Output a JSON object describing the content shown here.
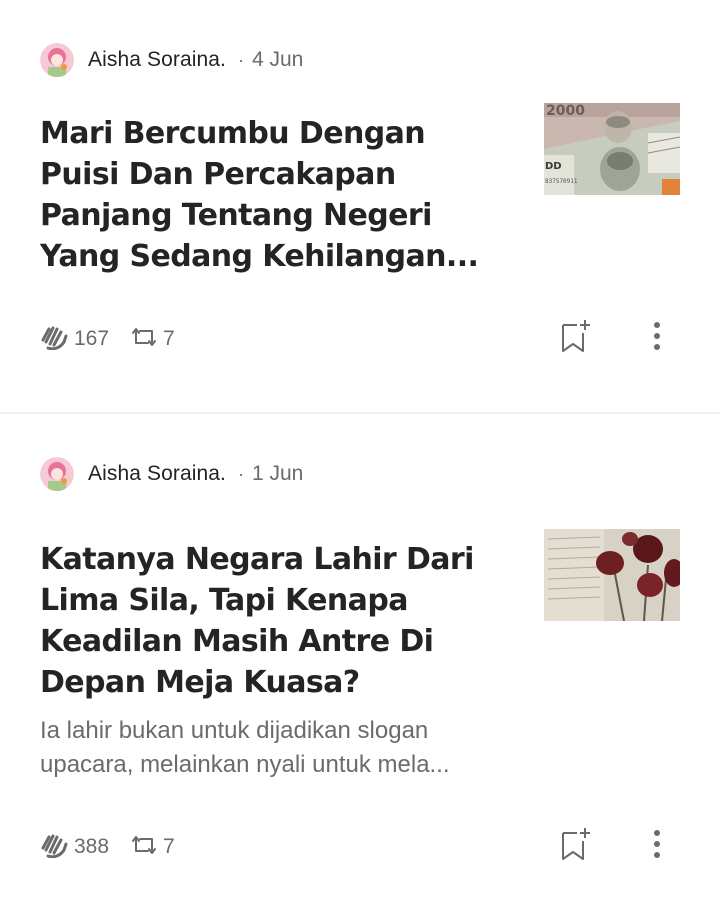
{
  "posts": [
    {
      "author": "Aisha Soraina.",
      "separator": "·",
      "date": "4 Jun",
      "title": "Mari Bercumbu Dengan Puisi Dan Percakapan Panjang Tentang Negeri Yang Sedang Kehilangan...",
      "subtitle": "",
      "claps": "167",
      "responses": "7",
      "thumbnail": "banknotes-photo"
    },
    {
      "author": "Aisha Soraina.",
      "separator": "·",
      "date": "1 Jun",
      "title": "Katanya Negara Lahir Dari Lima Sila, Tapi Kenapa Keadilan Masih Antre Di Depan Meja Kuasa?",
      "subtitle": "Ia lahir bukan untuk dijadikan slogan upacara, melainkan nyali untuk mela...",
      "claps": "388",
      "responses": "7",
      "thumbnail": "dried-roses-photo"
    }
  ],
  "icons": {
    "clap": "clap-icon",
    "repost": "repost-icon",
    "bookmark": "bookmark-add-icon",
    "more": "more-vertical-icon"
  },
  "colors": {
    "text_primary": "#242424",
    "text_secondary": "#6b6b6b",
    "divider": "#f0f0f0"
  }
}
